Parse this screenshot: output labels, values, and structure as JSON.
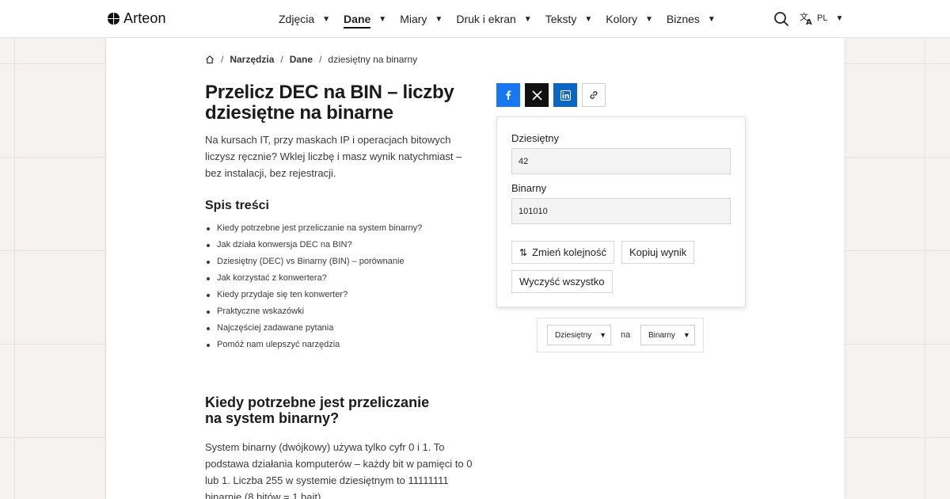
{
  "header": {
    "logo": "Arteon",
    "nav": [
      {
        "label": "Zdjęcia",
        "active": false
      },
      {
        "label": "Dane",
        "active": true
      },
      {
        "label": "Miary",
        "active": false
      },
      {
        "label": "Druk i ekran",
        "active": false
      },
      {
        "label": "Teksty",
        "active": false
      },
      {
        "label": "Kolory",
        "active": false
      },
      {
        "label": "Biznes",
        "active": false
      }
    ],
    "language": "PL"
  },
  "breadcrumb": {
    "items": [
      "Narzędzia",
      "Dane",
      "dziesiętny na binarny"
    ]
  },
  "page": {
    "title": "Przelicz DEC na BIN – liczby dziesiętne na binarne",
    "intro": "Na kursach IT, przy maskach IP i operacjach bitowych liczysz ręcznie? Wklej liczbę i masz wynik natychmiast – bez instalacji, bez rejestracji."
  },
  "toc": {
    "title": "Spis treści",
    "items": [
      "Kiedy potrzebne jest przeliczanie na system binarny?",
      "Jak działa konwersja DEC na BIN?",
      "Dziesiętny (DEC) vs Binarny (BIN) – porównanie",
      "Jak korzystać z konwertera?",
      "Kiedy przydaje się ten konwerter?",
      "Praktyczne wskazówki",
      "Najczęściej zadawane pytania",
      "Pomóż nam ulepszyć narzędzia"
    ]
  },
  "section": {
    "title": "Kiedy potrzebne jest przeliczanie na system binarny?",
    "text": "System binarny (dwójkowy) używa tylko cyfr 0 i 1. To podstawa działania komputerów – każdy bit w pamięci to 0 lub 1. Liczba 255 w systemie dziesiętnym to 11111111 binarnie (8 bitów = 1 bajt)."
  },
  "converter": {
    "input_label": "Dziesiętny",
    "input_value": "42",
    "output_label": "Binarny",
    "output_value": "101010",
    "swap_label": "Zmień kolejność",
    "copy_label": "Kopiuj wynik",
    "clear_label": "Wyczyść wszystko"
  },
  "units": {
    "from": "Dziesiętny",
    "connector": "na",
    "to": "Binarny"
  },
  "colors": {
    "facebook": "#1877f2",
    "x": "#111111",
    "linkedin": "#0a66c2"
  }
}
